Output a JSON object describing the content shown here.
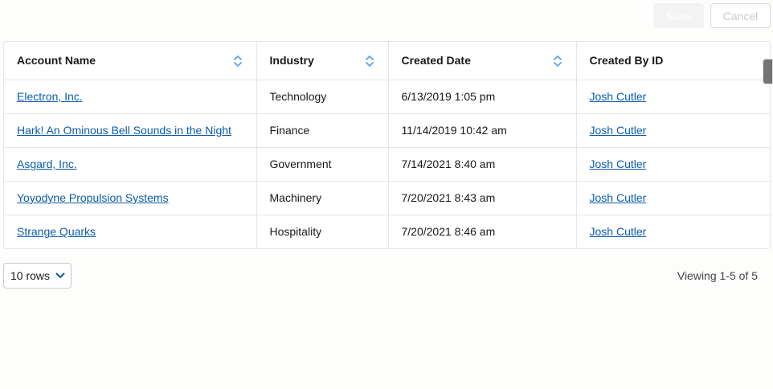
{
  "actions": {
    "save_label": "Save",
    "cancel_label": "Cancel"
  },
  "table": {
    "columns": [
      {
        "label": "Account Name",
        "sortable": true
      },
      {
        "label": "Industry",
        "sortable": true
      },
      {
        "label": "Created Date",
        "sortable": true
      },
      {
        "label": "Created By ID",
        "sortable": false
      }
    ],
    "rows": [
      {
        "account": "Electron, Inc.",
        "industry": "Technology",
        "created": "6/13/2019 1:05 pm",
        "created_by": "Josh Cutler"
      },
      {
        "account": "Hark! An Ominous Bell Sounds in the Night",
        "industry": "Finance",
        "created": "11/14/2019 10:42 am",
        "created_by": "Josh Cutler"
      },
      {
        "account": "Asgard, Inc.",
        "industry": "Government",
        "created": "7/14/2021 8:40 am",
        "created_by": "Josh Cutler"
      },
      {
        "account": "Yoyodyne Propulsion Systems",
        "industry": "Machinery",
        "created": "7/20/2021 8:43 am",
        "created_by": "Josh Cutler"
      },
      {
        "account": "Strange Quarks",
        "industry": "Hospitality",
        "created": "7/20/2021 8:46 am",
        "created_by": "Josh Cutler"
      }
    ]
  },
  "footer": {
    "rows_selected": "10 rows",
    "viewing": "Viewing 1-5 of 5"
  },
  "colors": {
    "link": "#0b5cab",
    "sort_icon": "#5aa8e6",
    "border": "#e5e5e5"
  },
  "icons": {
    "sort": "sort-updown-icon",
    "dropdown": "chevron-down-icon"
  }
}
